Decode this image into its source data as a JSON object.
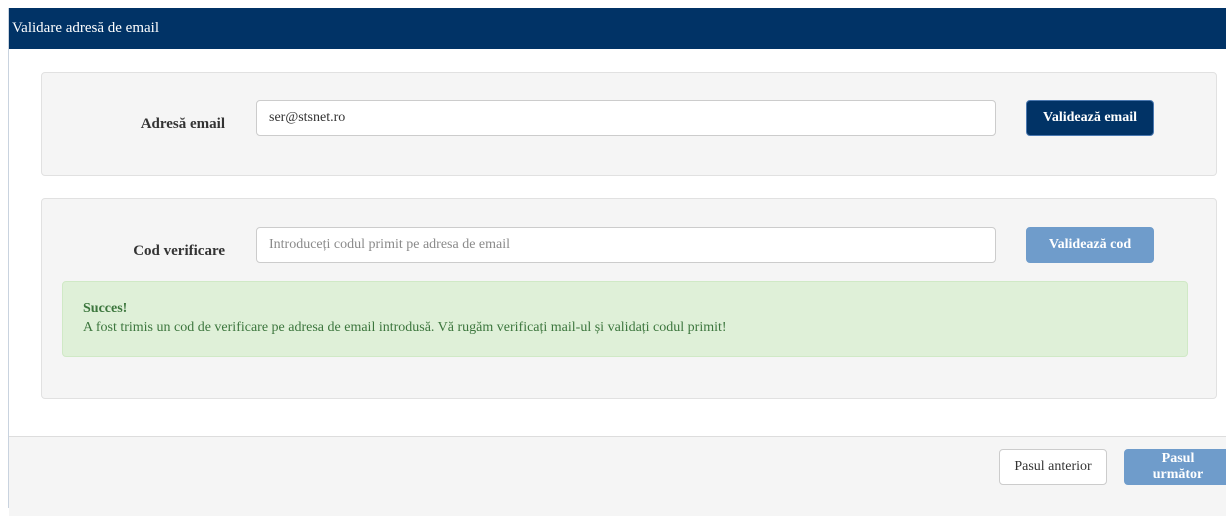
{
  "header": {
    "title": "Validare adresă de email"
  },
  "email_section": {
    "label": "Adresă email",
    "value": "ser@stsnet.ro",
    "button_label": "Validează email"
  },
  "code_section": {
    "label": "Cod verificare",
    "value": "",
    "placeholder": "Introduceți codul primit pe adresa de email",
    "button_label": "Validează cod"
  },
  "alert": {
    "title": "Succes!",
    "message": "A fost trimis un cod de verificare pe adresa de email introdusă. Vă rugăm verificați mail-ul și validați codul primit!"
  },
  "footer": {
    "prev_label": "Pasul anterior",
    "next_label": "Pasul următor"
  },
  "colors": {
    "header_bg": "#013366",
    "primary_button": "#013366",
    "disabled_button": "#6f9ccb",
    "success_bg": "#dff0d8",
    "success_text": "#3c763d"
  }
}
